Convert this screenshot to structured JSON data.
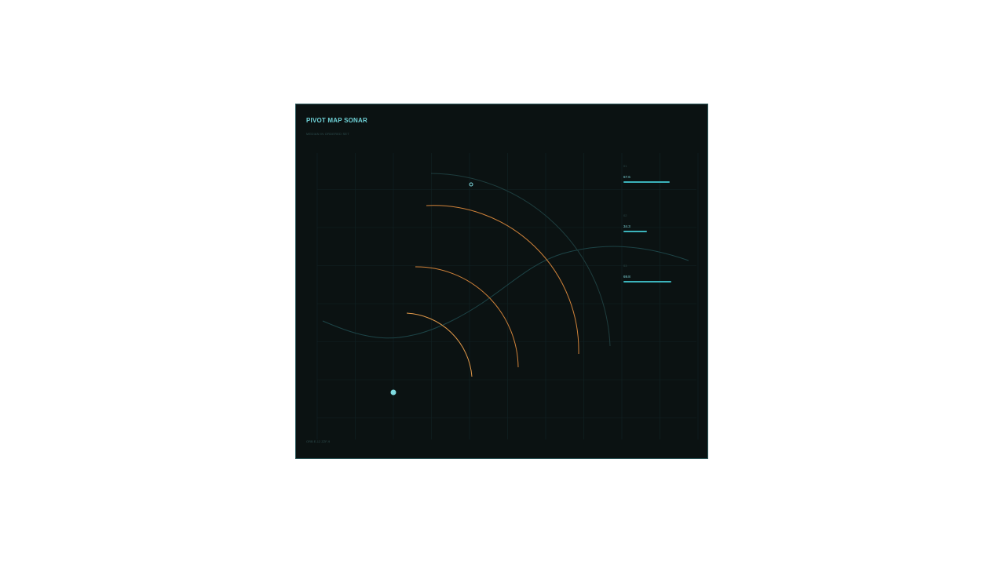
{
  "panel": {
    "title": "PIVOT MAP SONAR",
    "subtitle": "MEDIAN IN ORDERED SET",
    "footer": "ORB E-12 ZZF-9"
  },
  "metrics": [
    {
      "label": "01",
      "value": "67.6",
      "fraction": 0.676
    },
    {
      "label": "02",
      "value": "34.3",
      "fraction": 0.343
    },
    {
      "label": "03",
      "value": "69.8",
      "fraction": 0.698
    }
  ],
  "colors": {
    "background": "#0b1212",
    "border": "#2f5d60",
    "accent": "#6fd3d8",
    "arc": "#d1833a",
    "outer_arc": "#1e3d3e",
    "curve": "#1d4447",
    "grid": "#122325",
    "bar": "#3bb3bb"
  },
  "diagram": {
    "arcs": [
      "arc-inner",
      "arc-middle",
      "arc-outer",
      "arc-faint"
    ],
    "markers": [
      "pivot-marker",
      "scan-marker"
    ]
  }
}
